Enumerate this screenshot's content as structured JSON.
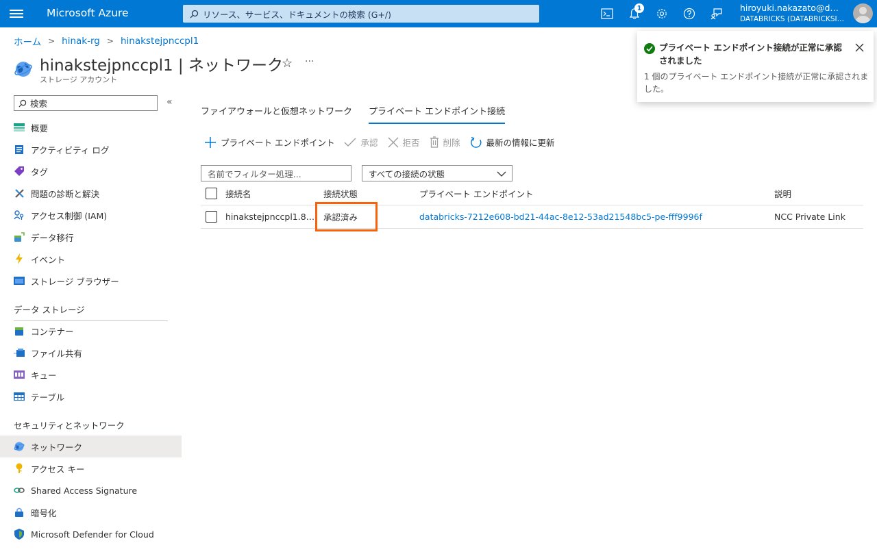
{
  "topbar": {
    "brand": "Microsoft Azure",
    "search_placeholder": "リソース、サービス、ドキュメントの検索 (G+/)",
    "notification_count": "1",
    "user_name": "hiroyuki.nakazato@d…",
    "tenant": "DATABRICKS (DATABRICKSI…"
  },
  "breadcrumb": [
    "ホーム",
    "hinak-rg",
    "hinakstejpnccpl1"
  ],
  "resource": {
    "title": "hinakstejpnccpl1 | ネットワーク",
    "subtitle": "ストレージ アカウント"
  },
  "sidebar": {
    "search_placeholder": "検索",
    "items": [
      {
        "label": "概要",
        "icon": "overview-icon"
      },
      {
        "label": "アクティビティ ログ",
        "icon": "activity-log-icon"
      },
      {
        "label": "タグ",
        "icon": "tag-icon"
      },
      {
        "label": "問題の診断と解決",
        "icon": "diagnose-icon"
      },
      {
        "label": "アクセス制御 (IAM)",
        "icon": "iam-icon"
      },
      {
        "label": "データ移行",
        "icon": "data-migration-icon"
      },
      {
        "label": "イベント",
        "icon": "events-icon"
      },
      {
        "label": "ストレージ ブラウザー",
        "icon": "storage-browser-icon"
      }
    ],
    "section_data_storage": "データ ストレージ",
    "data_storage_items": [
      {
        "label": "コンテナー",
        "icon": "container-icon"
      },
      {
        "label": "ファイル共有",
        "icon": "file-share-icon"
      },
      {
        "label": "キュー",
        "icon": "queue-icon"
      },
      {
        "label": "テーブル",
        "icon": "table-icon"
      }
    ],
    "section_security": "セキュリティとネットワーク",
    "security_items": [
      {
        "label": "ネットワーク",
        "icon": "network-icon"
      },
      {
        "label": "アクセス キー",
        "icon": "access-key-icon"
      },
      {
        "label": "Shared Access Signature",
        "icon": "sas-icon"
      },
      {
        "label": "暗号化",
        "icon": "encryption-icon"
      },
      {
        "label": "Microsoft Defender for Cloud",
        "icon": "defender-icon"
      }
    ]
  },
  "tabs": [
    "ファイアウォールと仮想ネットワーク",
    "プライベート エンドポイント接続"
  ],
  "active_tab": "プライベート エンドポイント接続",
  "toolbar": {
    "add": "プライベート エンドポイント",
    "approve": "承認",
    "reject": "拒否",
    "delete": "削除",
    "refresh": "最新の情報に更新"
  },
  "filter": {
    "placeholder": "名前でフィルター処理...",
    "status_dropdown": "すべての接続の状態"
  },
  "table": {
    "headers": [
      "接続名",
      "接続状態",
      "プライベート エンドポイント",
      "説明"
    ],
    "rows": [
      {
        "name": "hinakstejpnccpl1.8…",
        "status": "承認済み",
        "endpoint": "databricks-7212e608-bd21-44ac-8e12-53ad21548bc5-pe-fff9996f",
        "description": "NCC Private Link"
      }
    ]
  },
  "toast": {
    "title": "プライベート エンドポイント接続が正常に承認されました",
    "body": "1 個のプライベート エンドポイント接続が正常に承認されました。"
  },
  "colors": {
    "azure_blue": "#0078d4",
    "highlight": "#f7630c",
    "success": "#107c10"
  }
}
